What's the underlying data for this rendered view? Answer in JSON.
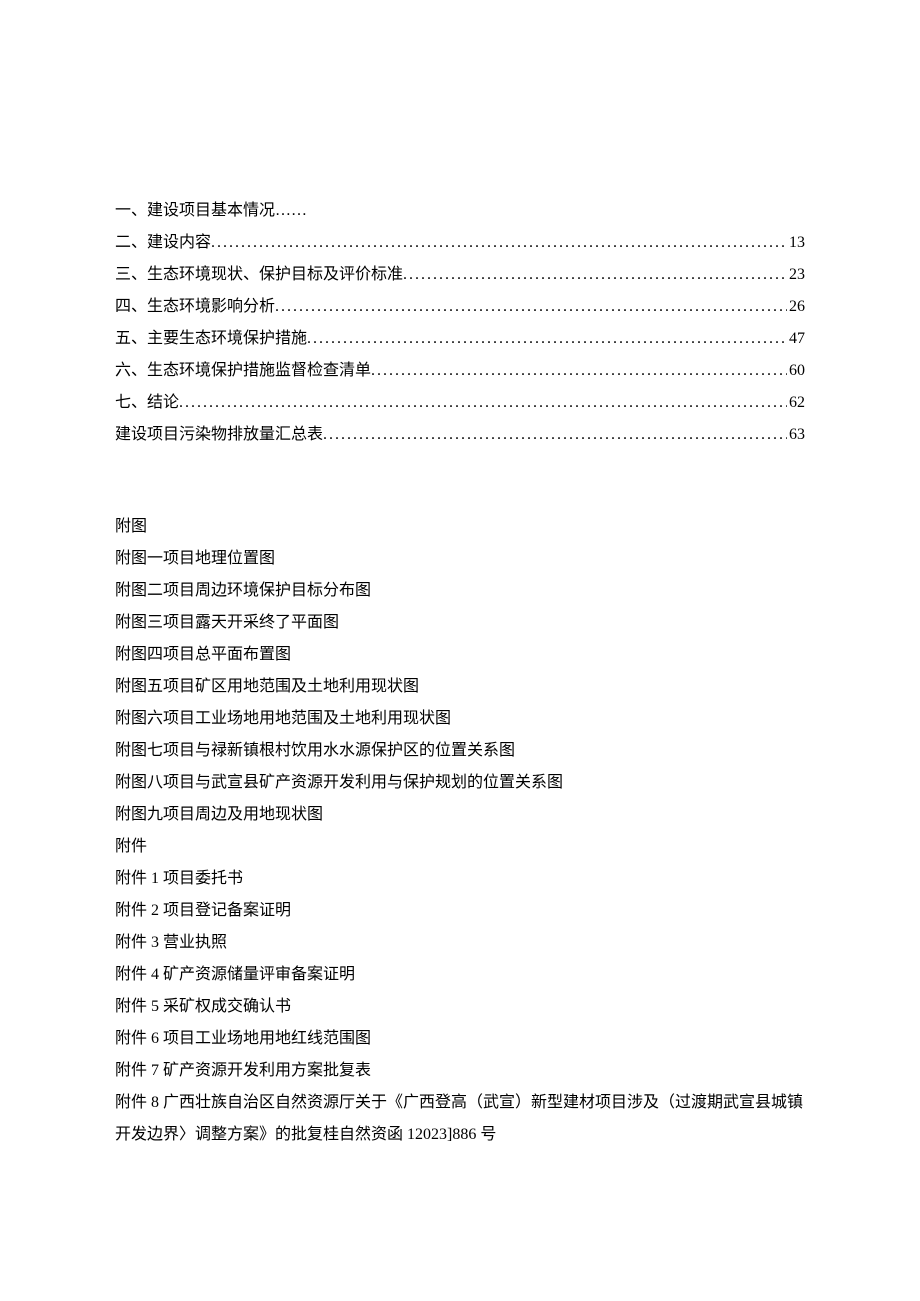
{
  "toc": [
    {
      "label": "一、建设项目基本情况……",
      "page": ""
    },
    {
      "label": "二、建设内容",
      "page": "13"
    },
    {
      "label": "三、生态环境现状、保护目标及评价标准",
      "page": "23"
    },
    {
      "label": "四、生态环境影响分析",
      "page": "26"
    },
    {
      "label": "五、主要生态环境保护措施",
      "page": "47"
    },
    {
      "label": "六、生态环境保护措施监督检查清单",
      "page": "60"
    },
    {
      "label": "七、结论",
      "page": "62"
    },
    {
      "label": "建设项目污染物排放量汇总表",
      "page": "63"
    }
  ],
  "figures_header": "附图",
  "figures": [
    "附图一项目地理位置图",
    "附图二项目周边环境保护目标分布图",
    "附图三项目露天开采终了平面图",
    "附图四项目总平面布置图",
    "附图五项目矿区用地范围及土地利用现状图",
    "附图六项目工业场地用地范围及土地利用现状图",
    "附图七项目与禄新镇根村饮用水水源保护区的位置关系图",
    "附图八项目与武宣县矿产资源开发利用与保护规划的位置关系图",
    "附图九项目周边及用地现状图"
  ],
  "attachments_header": "附件",
  "attachments": [
    "附件 1 项目委托书",
    "附件 2 项目登记备案证明",
    "附件 3 营业执照",
    "附件 4 矿产资源储量评审备案证明",
    "附件 5 采矿权成交确认书",
    "附件 6 项目工业场地用地红线范围图",
    "附件 7 矿产资源开发利用方案批复表",
    "附件 8 广西壮族自治区自然资源厅关于《广西登高（武宣）新型建材项目涉及（过渡期武宣县城镇开发边界〉调整方案》的批复桂自然资函 12023]886 号"
  ]
}
